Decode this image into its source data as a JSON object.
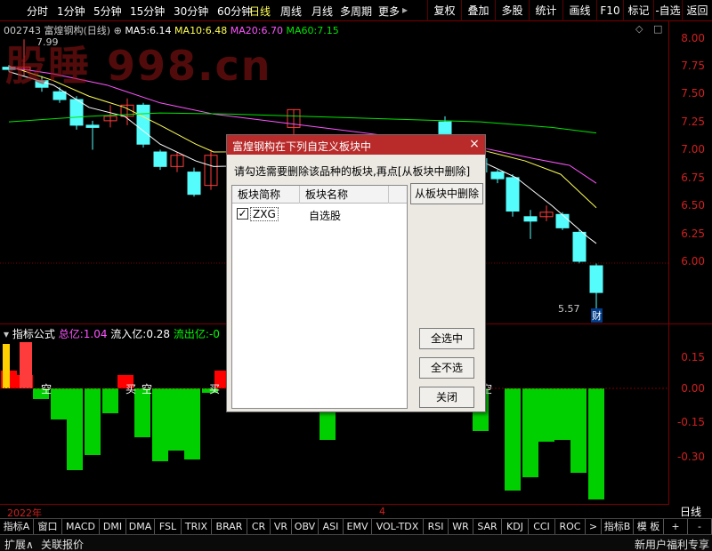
{
  "toolbar": {
    "periods": [
      "分时",
      "1分钟",
      "5分钟",
      "15分钟",
      "30分钟",
      "60分钟",
      "日线",
      "周线",
      "月线",
      "多周期",
      "更多"
    ],
    "more_arrow": "▸",
    "tools": [
      "复权",
      "叠加",
      "多股",
      "统计",
      "画线",
      "F10",
      "标记",
      "-自选",
      "返回"
    ]
  },
  "main_chart": {
    "stock_code": "002743",
    "stock_name": "富煌钢构(日线)",
    "ma5_label": "MA5:",
    "ma5_value": "6.14",
    "ma10_label": "MA10:",
    "ma10_value": "6.48",
    "ma20_label": "MA20:",
    "ma20_value": "6.70",
    "ma60_label": "MA60:",
    "ma60_value": "7.15",
    "high_marker": "7.99",
    "low_marker": "5.57",
    "finance_tag": "财",
    "watermark": "股睡 998.cn",
    "price_ticks": [
      "8.00",
      "7.75",
      "7.50",
      "7.25",
      "7.00",
      "6.75",
      "6.50",
      "6.25",
      "6.00"
    ],
    "colors": {
      "up": "#ff3c3c",
      "down": "#54fcfc",
      "ma5": "#ffffff",
      "ma10": "#ffff54",
      "ma20": "#ff54ff",
      "ma60": "#00e600"
    }
  },
  "indicator": {
    "arrow": "▾",
    "name": "指标公式",
    "total_label": "总亿:",
    "total_value": "1.04",
    "inflow_label": "流入亿:",
    "inflow_value": "0.28",
    "outflow_label": "流出亿:",
    "outflow_value": "-0",
    "ticks": [
      "0.15",
      "0.00",
      "-0.15",
      "-0.30"
    ],
    "annotations": [
      "空",
      "买",
      "空",
      "买",
      "空",
      "买",
      "空"
    ],
    "colors": {
      "buy": "#ff0000",
      "sell": "#00d000",
      "total": "#ff54ff",
      "inflow": "#ffffff",
      "outflow": "#00ff00"
    }
  },
  "timeline": {
    "year_label": "2022年",
    "month_label": "4",
    "period_indicator": "日线"
  },
  "indicator_tabs": [
    "指标A",
    "窗口",
    "MACD",
    "DMI",
    "DMA",
    "FSL",
    "TRIX",
    "BRAR",
    "CR",
    "VR",
    "OBV",
    "ASI",
    "EMV",
    "VOL-TDX",
    "RSI",
    "WR",
    "SAR",
    "KDJ",
    "CCI",
    "ROC",
    ">",
    "指标B",
    "模 板",
    "+",
    "-"
  ],
  "statusbar": {
    "expand": "扩展∧",
    "related": "关联报价",
    "promo": "新用户福利专享"
  },
  "dialog": {
    "title": "富煌钢构在下列自定义板块中",
    "close": "×",
    "instruction": "请勾选需要删除该品种的板块,再点[从板块中删除]",
    "columns": [
      "板块简称",
      "板块名称"
    ],
    "rows": [
      {
        "checked": "✓",
        "code": "ZXG",
        "name": "自选股"
      }
    ],
    "delete_button": "从板块中删除",
    "select_all": "全选中",
    "select_none": "全不选",
    "close_button": "关闭"
  }
}
